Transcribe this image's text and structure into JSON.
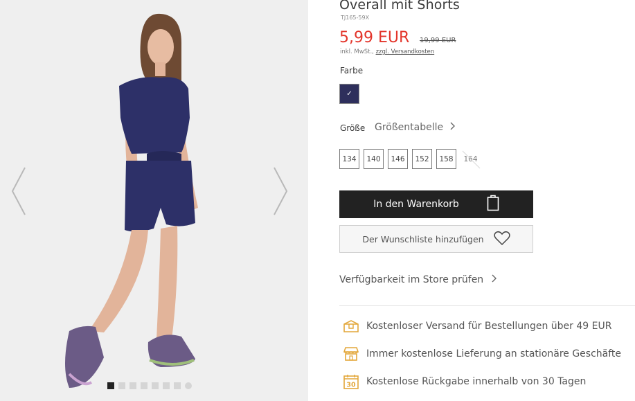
{
  "product": {
    "title": "Overall mit Shorts",
    "sku": "TJ165-59X",
    "price": "5,99 EUR",
    "old_price": "19,99 EUR",
    "tax_prefix": "inkl. MwSt., ",
    "shipping_link": "zzgl. Versandkosten"
  },
  "color": {
    "label": "Farbe",
    "selected_hex": "#2e2f5c"
  },
  "size": {
    "label": "Größe",
    "chart_link": "Größentabelle",
    "options": [
      {
        "value": "134",
        "available": true
      },
      {
        "value": "140",
        "available": true
      },
      {
        "value": "146",
        "available": true
      },
      {
        "value": "152",
        "available": true
      },
      {
        "value": "158",
        "available": true
      },
      {
        "value": "164",
        "available": false
      }
    ]
  },
  "actions": {
    "add_to_cart": "In den Warenkorb",
    "wishlist": "Der Wunschliste hinzufügen",
    "store_availability": "Verfügbarkeit im Store prüfen"
  },
  "benefits": [
    {
      "icon": "delivery-box-icon",
      "text": "Kostenloser Versand für Bestellungen über 49 EUR"
    },
    {
      "icon": "store-icon",
      "text": "Immer kostenlose Lieferung an stationäre Geschäfte"
    },
    {
      "icon": "calendar-30-icon",
      "text": "Kostenlose Rückgabe innerhalb von 30 Tagen",
      "icon_text": "30"
    }
  ],
  "gallery": {
    "image_count": 8,
    "active_index": 0
  },
  "colors": {
    "price_red": "#e3352b",
    "accent_gold": "#e3a73a",
    "button_dark": "#222222"
  }
}
